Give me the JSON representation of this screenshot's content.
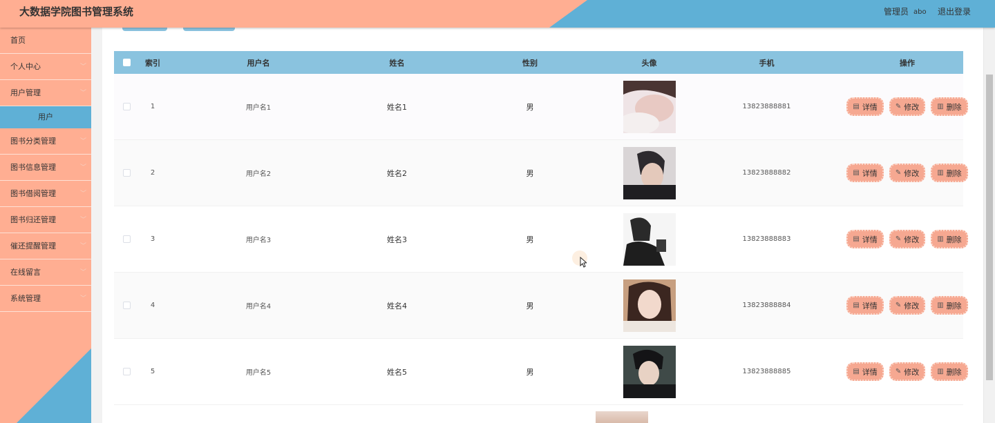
{
  "header": {
    "title": "大数据学院图书管理系统",
    "role": "管理员",
    "username": "abo",
    "logout": "退出登录"
  },
  "sidebar": {
    "items": [
      {
        "label": "首页",
        "has_chevron": false
      },
      {
        "label": "个人中心",
        "has_chevron": true
      },
      {
        "label": "用户管理",
        "has_chevron": true
      },
      {
        "label": "用户",
        "sub": true
      },
      {
        "label": "图书分类管理",
        "has_chevron": true
      },
      {
        "label": "图书信息管理",
        "has_chevron": true
      },
      {
        "label": "图书借阅管理",
        "has_chevron": true
      },
      {
        "label": "图书归还管理",
        "has_chevron": true
      },
      {
        "label": "催还提醒管理",
        "has_chevron": true
      },
      {
        "label": "在线留言",
        "has_chevron": true
      },
      {
        "label": "系统管理",
        "has_chevron": true
      }
    ]
  },
  "table": {
    "headers": {
      "index": "索引",
      "username": "用户名",
      "name": "姓名",
      "sex": "性别",
      "avatar": "头像",
      "phone": "手机",
      "ops": "操作"
    },
    "actions": {
      "detail": "详情",
      "edit": "修改",
      "delete": "删除"
    },
    "rows": [
      {
        "index": "1",
        "username": "用户名1",
        "name": "姓名1",
        "sex": "男",
        "phone": "13823888881"
      },
      {
        "index": "2",
        "username": "用户名2",
        "name": "姓名2",
        "sex": "男",
        "phone": "13823888882"
      },
      {
        "index": "3",
        "username": "用户名3",
        "name": "姓名3",
        "sex": "男",
        "phone": "13823888883"
      },
      {
        "index": "4",
        "username": "用户名4",
        "name": "姓名4",
        "sex": "男",
        "phone": "13823888884"
      },
      {
        "index": "5",
        "username": "用户名5",
        "name": "姓名5",
        "sex": "男",
        "phone": "13823888885"
      }
    ]
  },
  "colors": {
    "header_salmon": "#ffae92",
    "header_blue": "#5fb0d6",
    "table_header": "#8ac3df",
    "button": "#f6a891"
  },
  "icons": {
    "detail": "document-icon",
    "edit": "pencil-icon",
    "delete": "trash-icon",
    "chevron": "chevron-down-icon"
  }
}
